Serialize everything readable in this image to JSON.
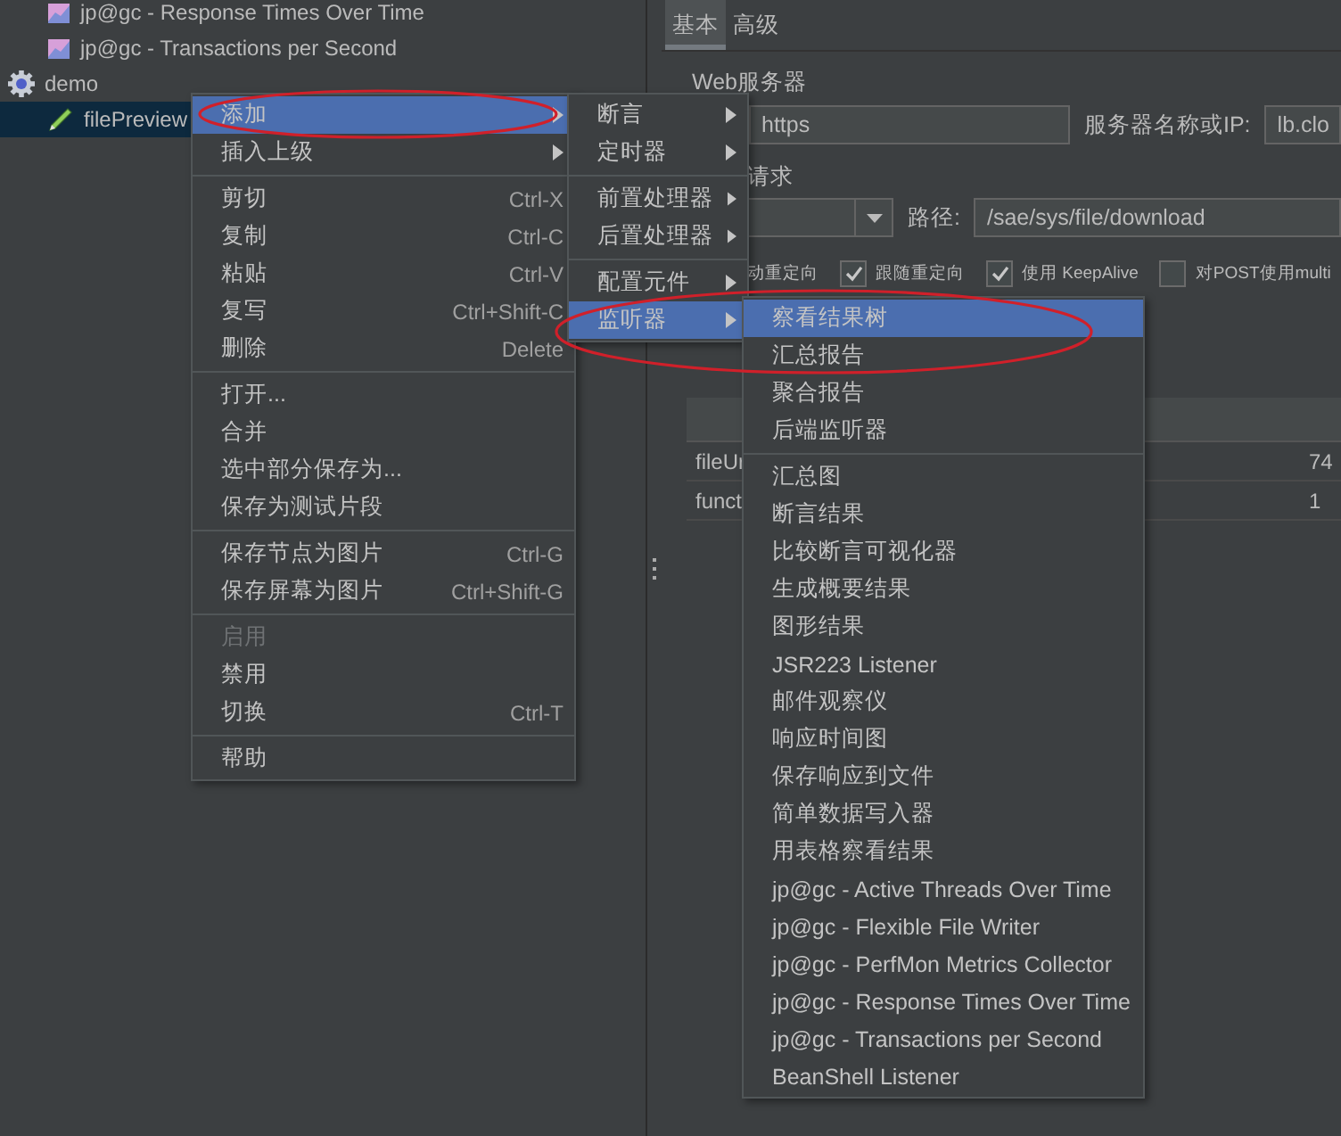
{
  "tree": [
    {
      "kind": "listener",
      "label": "jp@gc - Response Times Over Time",
      "selected": false
    },
    {
      "kind": "listener",
      "label": "jp@gc - Transactions per Second",
      "selected": false
    },
    {
      "kind": "plan",
      "label": "demo",
      "selected": false,
      "children": [
        {
          "kind": "sampler",
          "label": "filePreview",
          "selected": true
        }
      ]
    }
  ],
  "context_menu": {
    "items": [
      {
        "kind": "item",
        "label": "添加",
        "has_submenu": true,
        "selected": true,
        "disabled": false
      },
      {
        "kind": "item",
        "label": "插入上级",
        "has_submenu": true,
        "selected": false,
        "disabled": false
      },
      {
        "kind": "separator"
      },
      {
        "kind": "item",
        "label": "剪切",
        "shortcut": "Ctrl-X",
        "has_submenu": false,
        "selected": false,
        "disabled": false
      },
      {
        "kind": "item",
        "label": "复制",
        "shortcut": "Ctrl-C",
        "has_submenu": false,
        "selected": false,
        "disabled": false
      },
      {
        "kind": "item",
        "label": "粘贴",
        "shortcut": "Ctrl-V",
        "has_submenu": false,
        "selected": false,
        "disabled": false
      },
      {
        "kind": "item",
        "label": "复写",
        "shortcut": "Ctrl+Shift-C",
        "has_submenu": false,
        "selected": false,
        "disabled": false
      },
      {
        "kind": "item",
        "label": "删除",
        "shortcut": "Delete",
        "has_submenu": false,
        "selected": false,
        "disabled": false
      },
      {
        "kind": "separator"
      },
      {
        "kind": "item",
        "label": "打开...",
        "has_submenu": false,
        "selected": false,
        "disabled": false
      },
      {
        "kind": "item",
        "label": "合并",
        "has_submenu": false,
        "selected": false,
        "disabled": false
      },
      {
        "kind": "item",
        "label": "选中部分保存为...",
        "has_submenu": false,
        "selected": false,
        "disabled": false
      },
      {
        "kind": "item",
        "label": "保存为测试片段",
        "has_submenu": false,
        "selected": false,
        "disabled": false
      },
      {
        "kind": "separator"
      },
      {
        "kind": "item",
        "label": "保存节点为图片",
        "shortcut": "Ctrl-G",
        "has_submenu": false,
        "selected": false,
        "disabled": false
      },
      {
        "kind": "item",
        "label": "保存屏幕为图片",
        "shortcut": "Ctrl+Shift-G",
        "has_submenu": false,
        "selected": false,
        "disabled": false
      },
      {
        "kind": "separator"
      },
      {
        "kind": "item",
        "label": "启用",
        "has_submenu": false,
        "selected": false,
        "disabled": true
      },
      {
        "kind": "item",
        "label": "禁用",
        "has_submenu": false,
        "selected": false,
        "disabled": false
      },
      {
        "kind": "item",
        "label": "切换",
        "shortcut": "Ctrl-T",
        "has_submenu": false,
        "selected": false,
        "disabled": false
      },
      {
        "kind": "separator"
      },
      {
        "kind": "item",
        "label": "帮助",
        "has_submenu": false,
        "selected": false,
        "disabled": false
      }
    ]
  },
  "add_submenu": {
    "items": [
      {
        "kind": "item",
        "label": "断言",
        "has_submenu": true,
        "selected": false,
        "disabled": false
      },
      {
        "kind": "item",
        "label": "定时器",
        "has_submenu": true,
        "selected": false,
        "disabled": false
      },
      {
        "kind": "separator"
      },
      {
        "kind": "item",
        "label": "前置处理器",
        "has_submenu": true,
        "selected": false,
        "disabled": false
      },
      {
        "kind": "item",
        "label": "后置处理器",
        "has_submenu": true,
        "selected": false,
        "disabled": false
      },
      {
        "kind": "separator"
      },
      {
        "kind": "item",
        "label": "配置元件",
        "has_submenu": true,
        "selected": false,
        "disabled": false
      },
      {
        "kind": "item",
        "label": "监听器",
        "has_submenu": true,
        "selected": true,
        "disabled": false
      }
    ]
  },
  "listener_submenu": {
    "items": [
      {
        "kind": "item",
        "label": "察看结果树",
        "selected": true,
        "disabled": false
      },
      {
        "kind": "item",
        "label": "汇总报告",
        "selected": false,
        "disabled": false
      },
      {
        "kind": "item",
        "label": "聚合报告",
        "selected": false,
        "disabled": false
      },
      {
        "kind": "item",
        "label": "后端监听器",
        "selected": false,
        "disabled": false
      },
      {
        "kind": "separator"
      },
      {
        "kind": "item",
        "label": "汇总图",
        "selected": false,
        "disabled": false
      },
      {
        "kind": "item",
        "label": "断言结果",
        "selected": false,
        "disabled": false
      },
      {
        "kind": "item",
        "label": "比较断言可视化器",
        "selected": false,
        "disabled": false
      },
      {
        "kind": "item",
        "label": "生成概要结果",
        "selected": false,
        "disabled": false
      },
      {
        "kind": "item",
        "label": "图形结果",
        "selected": false,
        "disabled": false
      },
      {
        "kind": "item",
        "label": "JSR223 Listener",
        "selected": false,
        "disabled": false
      },
      {
        "kind": "item",
        "label": "邮件观察仪",
        "selected": false,
        "disabled": false
      },
      {
        "kind": "item",
        "label": "响应时间图",
        "selected": false,
        "disabled": false
      },
      {
        "kind": "item",
        "label": "保存响应到文件",
        "selected": false,
        "disabled": false
      },
      {
        "kind": "item",
        "label": "简单数据写入器",
        "selected": false,
        "disabled": false
      },
      {
        "kind": "item",
        "label": "用表格察看结果",
        "selected": false,
        "disabled": false
      },
      {
        "kind": "item",
        "label": "jp@gc - Active Threads Over Time",
        "selected": false,
        "disabled": false
      },
      {
        "kind": "item",
        "label": "jp@gc - Flexible File Writer",
        "selected": false,
        "disabled": false
      },
      {
        "kind": "item",
        "label": "jp@gc - PerfMon Metrics Collector",
        "selected": false,
        "disabled": false
      },
      {
        "kind": "item",
        "label": "jp@gc - Response Times Over Time",
        "selected": false,
        "disabled": false
      },
      {
        "kind": "item",
        "label": "jp@gc - Transactions per Second",
        "selected": false,
        "disabled": false
      },
      {
        "kind": "item",
        "label": "BeanShell Listener",
        "selected": false,
        "disabled": false
      }
    ]
  },
  "tabs": [
    {
      "label": "基本",
      "selected": true
    },
    {
      "label": "高级",
      "selected": false
    }
  ],
  "web_server": {
    "legend": "Web服务器",
    "protocol": {
      "value": "https"
    },
    "server_label": "服务器名称或IP:",
    "server": {
      "value": "lb.clo"
    }
  },
  "request": {
    "legend": "请求",
    "path_label": "路径:",
    "path": {
      "value": "/sae/sys/file/download"
    },
    "options": [
      {
        "kind": "label",
        "label": "动重定向"
      },
      {
        "kind": "checkbox",
        "label": "跟随重定向",
        "checked": true
      },
      {
        "kind": "checkbox",
        "label": "使用 KeepAlive",
        "checked": true
      },
      {
        "kind": "checkbox",
        "label": "对POST使用multi",
        "checked": false
      }
    ]
  },
  "table": {
    "rows": [
      [
        "fileUr",
        "74"
      ],
      [
        "funct",
        "1"
      ]
    ]
  }
}
